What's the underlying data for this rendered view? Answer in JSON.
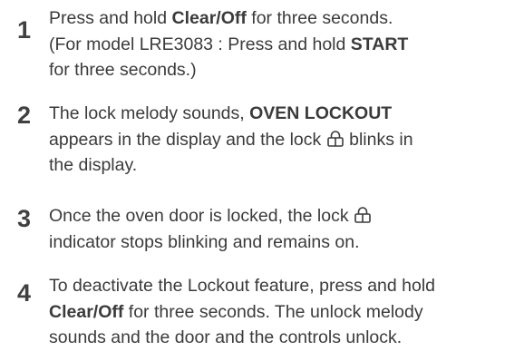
{
  "steps": [
    {
      "number": "1",
      "l1_a": "Press and hold ",
      "l1_b": "Clear/Off",
      "l1_c": " for three seconds.",
      "l2": "(For model  LRE3083 : Press and hold ",
      "l2_b": "START",
      "l3": "for three seconds.)"
    },
    {
      "number": "2",
      "l1_a": "The lock melody sounds, ",
      "l1_b": "OVEN LOCKOUT",
      "l2_a": "appears in the display and the lock ",
      "l2_b": " blinks in",
      "l3": "the display."
    },
    {
      "number": "3",
      "l1_a": "Once the oven door is locked, the lock ",
      "l2": "indicator stops blinking and remains on."
    },
    {
      "number": "4",
      "l1": "To deactivate the Lockout feature, press and hold",
      "l2_a": "Clear/Off",
      "l2_b": " for three seconds. The unlock melody",
      "l3": "sounds and the door and the controls unlock."
    }
  ],
  "icons": [
    "lock-icon"
  ],
  "colors": {
    "text": "#3b3b3b",
    "number": "#404040"
  }
}
